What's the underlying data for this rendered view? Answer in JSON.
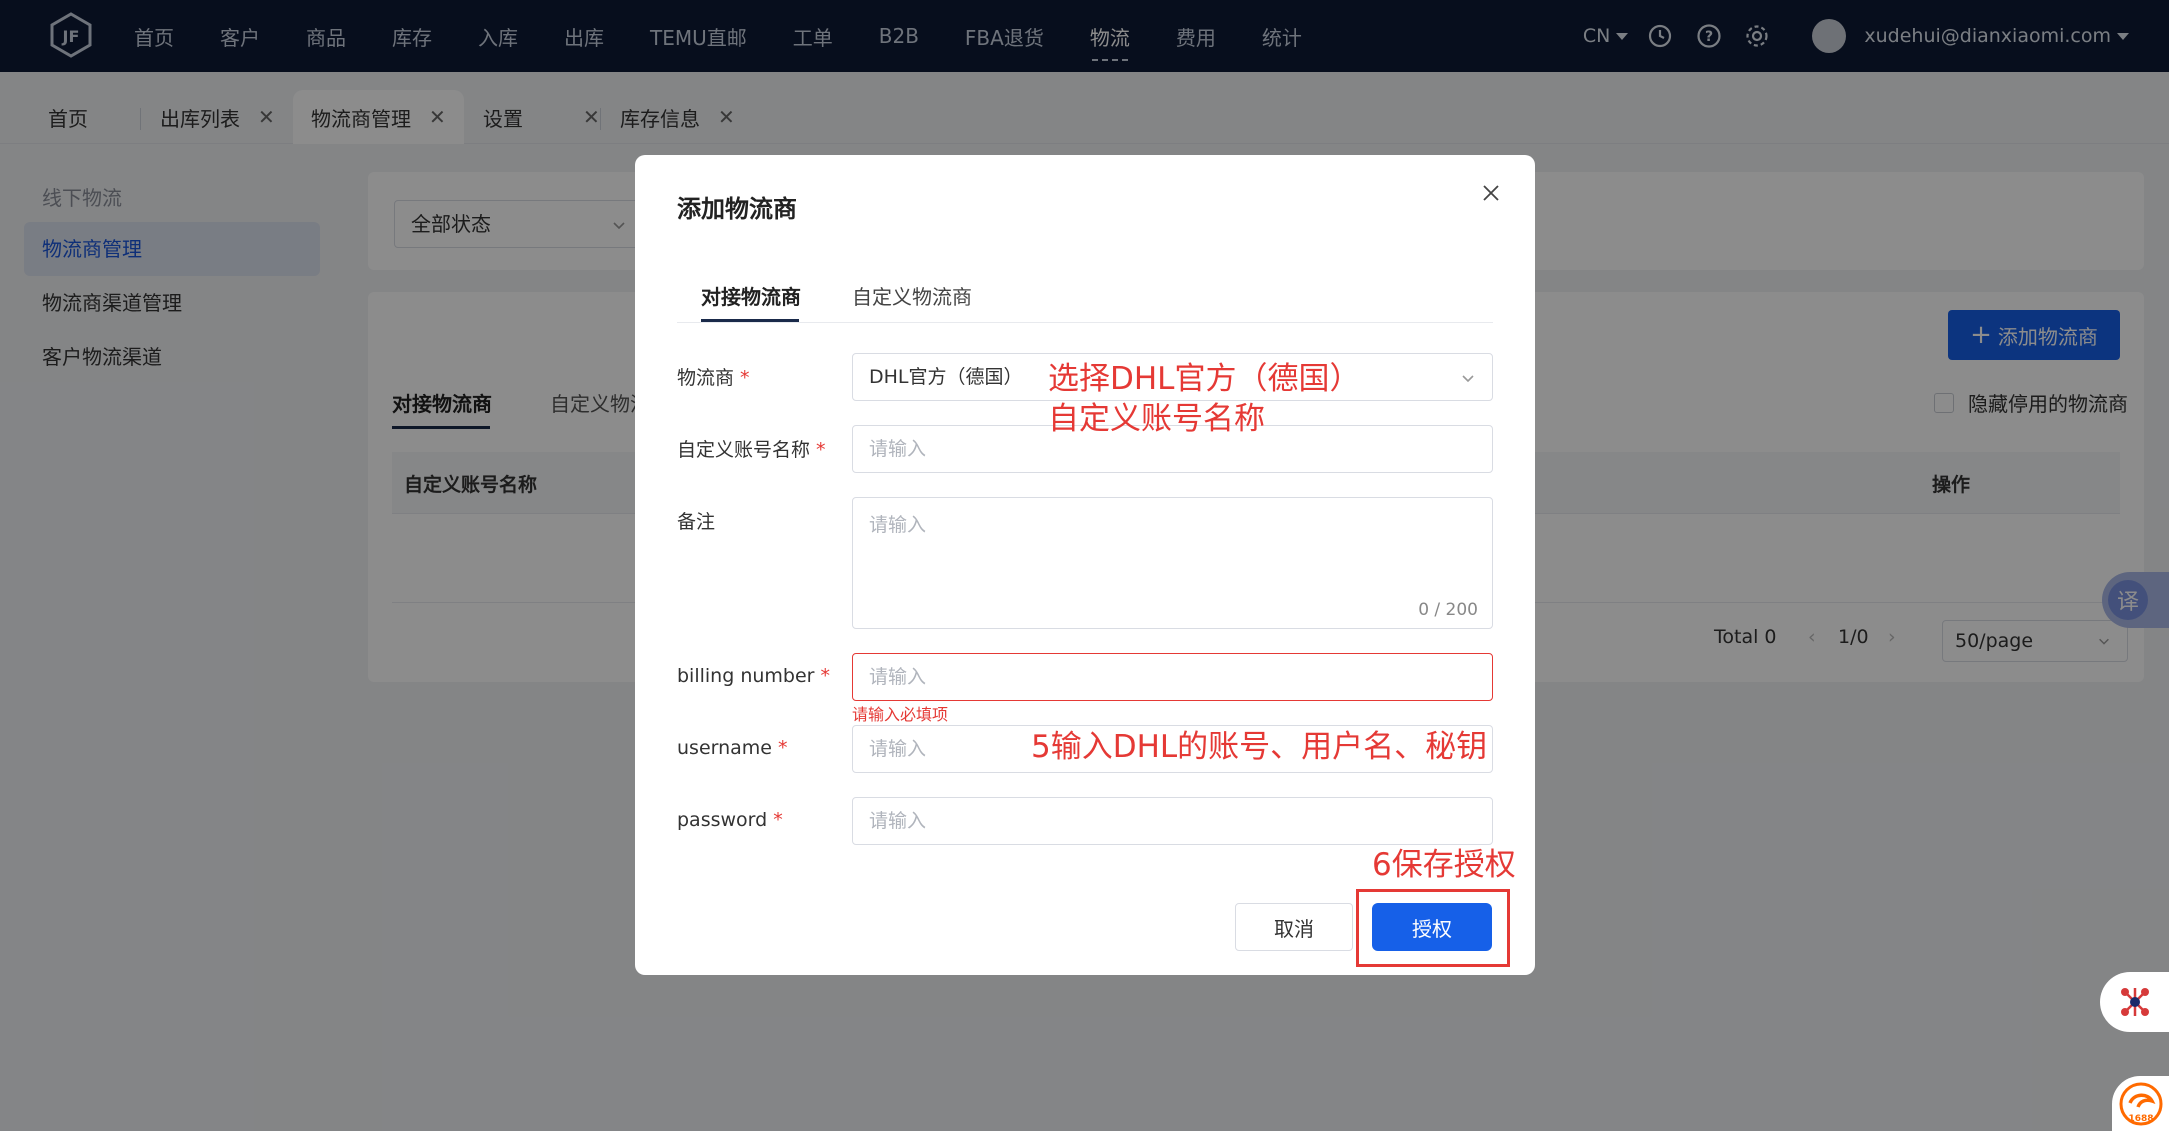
{
  "topnav": {
    "items": [
      "首页",
      "客户",
      "商品",
      "库存",
      "入库",
      "出库",
      "TEMU直邮",
      "工单",
      "B2B",
      "FBA退货",
      "物流",
      "费用",
      "统计"
    ],
    "active_index": 10,
    "lang": "CN",
    "user": "xudehui@dianxiaomi.com"
  },
  "tabs": [
    {
      "label": "首页"
    },
    {
      "label": "出库列表"
    },
    {
      "label": "物流商管理"
    },
    {
      "label": "设置"
    },
    {
      "label": "库存信息"
    }
  ],
  "sidebar": {
    "title": "线下物流",
    "items": [
      "物流商管理",
      "物流商渠道管理",
      "客户物流渠道"
    ]
  },
  "filter": {
    "status": "全部状态"
  },
  "main": {
    "add_button": "添加物流商",
    "tab_connect": "对接物流商",
    "tab_custom": "自定义物流",
    "hide_disabled": "隐藏停用的物流商",
    "col_name": "自定义账号名称",
    "col_ops": "操作",
    "total": "Total 0",
    "page": "1/0",
    "per_page": "50/page"
  },
  "modal": {
    "title": "添加物流商",
    "tab_connect": "对接物流商",
    "tab_custom": "自定义物流商",
    "fields": {
      "carrier_label": "物流商",
      "carrier_value": "DHL官方（德国）",
      "account_name_label": "自定义账号名称",
      "account_name_placeholder": "请输入",
      "remark_label": "备注",
      "remark_placeholder": "请输入",
      "remark_counter": "0 / 200",
      "billing_label": "billing number",
      "billing_placeholder": "请输入",
      "billing_error": "请输入必填项",
      "username_label": "username",
      "username_placeholder": "请输入",
      "password_label": "password",
      "password_placeholder": "请输入",
      "required_mark": "*"
    },
    "cancel": "取消",
    "authorize": "授权"
  },
  "annotations": {
    "a1": "选择DHL官方（德国）",
    "a2": "自定义账号名称",
    "a3": "5输入DHL的账号、用户名、秘钥",
    "a4": "6保存授权"
  },
  "widgets": {
    "translate": "译",
    "ali": "1688"
  },
  "colors": {
    "nav_bg": "#0e1a35",
    "primary": "#1660e8",
    "annotation_red": "#e53935"
  }
}
